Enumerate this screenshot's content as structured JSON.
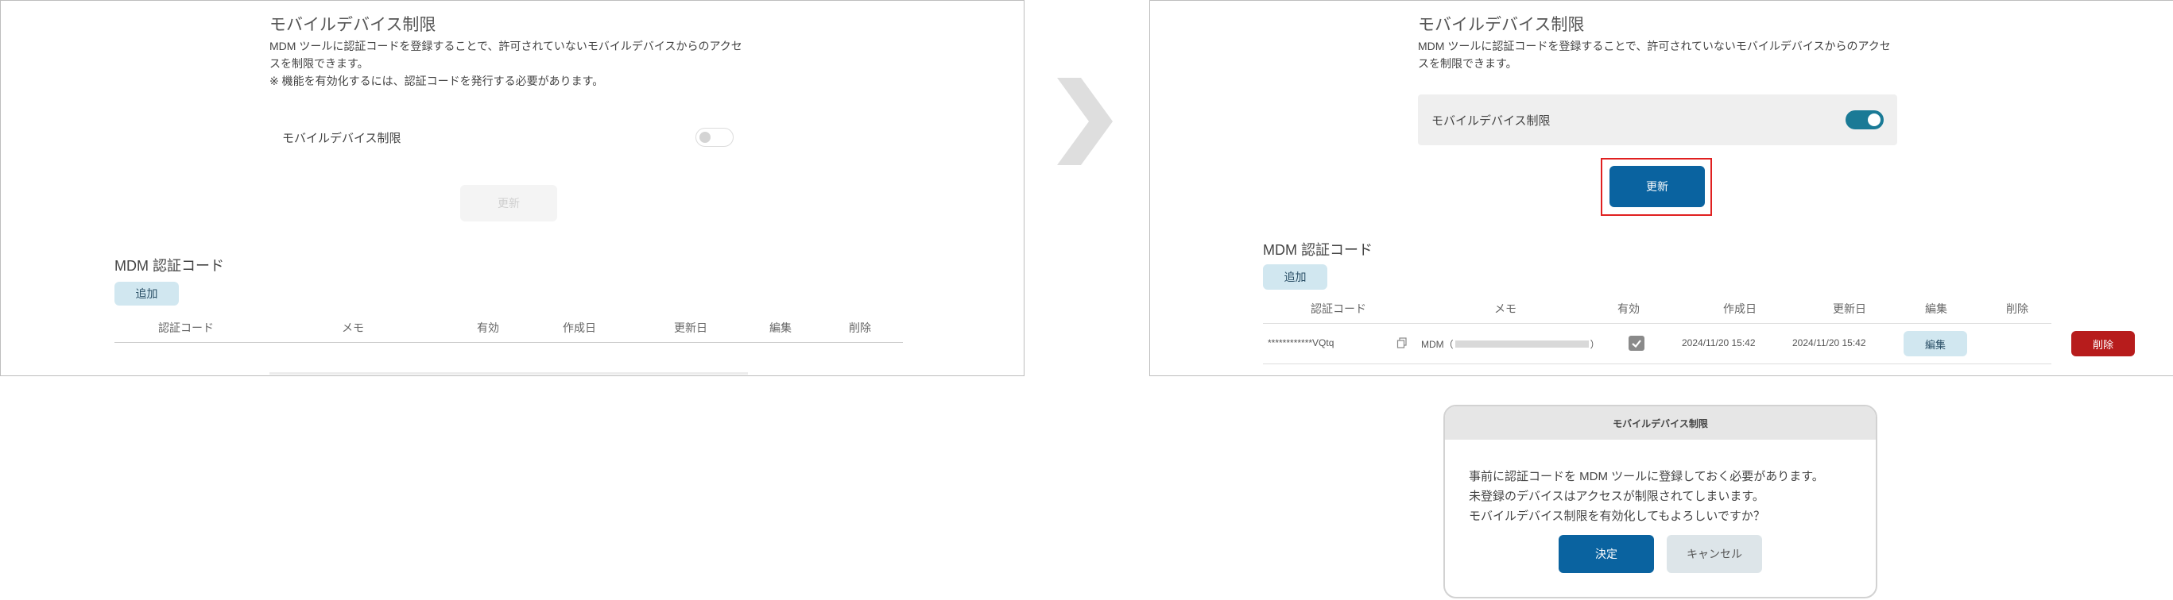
{
  "left_panel": {
    "section_title": "モバイルデバイス制限",
    "description_line1": "MDM ツールに認証コードを登録することで、許可されていないモバイルデバイスからのアクセ",
    "description_line2": "スを制限できます。",
    "note": "※ 機能を有効化するには、認証コードを発行する必要があります。",
    "toggle_label": "モバイルデバイス制限",
    "toggle_on": false,
    "update_button": "更新",
    "mdm_title": "MDM 認証コード",
    "add_button": "追加",
    "columns": [
      "認証コード",
      "メモ",
      "有効",
      "作成日",
      "更新日",
      "編集",
      "削除"
    ]
  },
  "right_panel": {
    "section_title": "モバイルデバイス制限",
    "description_line1": "MDM ツールに認証コードを登録することで、許可されていないモバイルデバイスからのアクセ",
    "description_line2": "スを制限できます。",
    "toggle_label": "モバイルデバイス制限",
    "toggle_on": true,
    "update_button": "更新",
    "mdm_title": "MDM 認証コード",
    "add_button": "追加",
    "columns": [
      "認証コード",
      "メモ",
      "有効",
      "作成日",
      "更新日",
      "編集",
      "削除"
    ],
    "row": {
      "code": "************VQtq",
      "memo_prefix": "MDM（",
      "memo_suffix": "）",
      "enabled": true,
      "created": "2024/11/20 15:42",
      "updated": "2024/11/20 15:42",
      "edit_button": "編集",
      "delete_button": "削除"
    }
  },
  "dialog": {
    "title": "モバイルデバイス制限",
    "message_line1": "事前に認証コードを MDM ツールに登録しておく必要があります。",
    "message_line2": "未登録のデバイスはアクセスが制限されてしまいます。",
    "message_line3": "モバイルデバイス制限を有効化してもよろしいですか？",
    "confirm_button": "決定",
    "cancel_button": "キャンセル"
  },
  "colors": {
    "primary": "#0a63a0",
    "toggle_on": "#1a7a96",
    "danger": "#b71c1c",
    "highlight_box": "#e02020",
    "arrow": "#dedede"
  }
}
